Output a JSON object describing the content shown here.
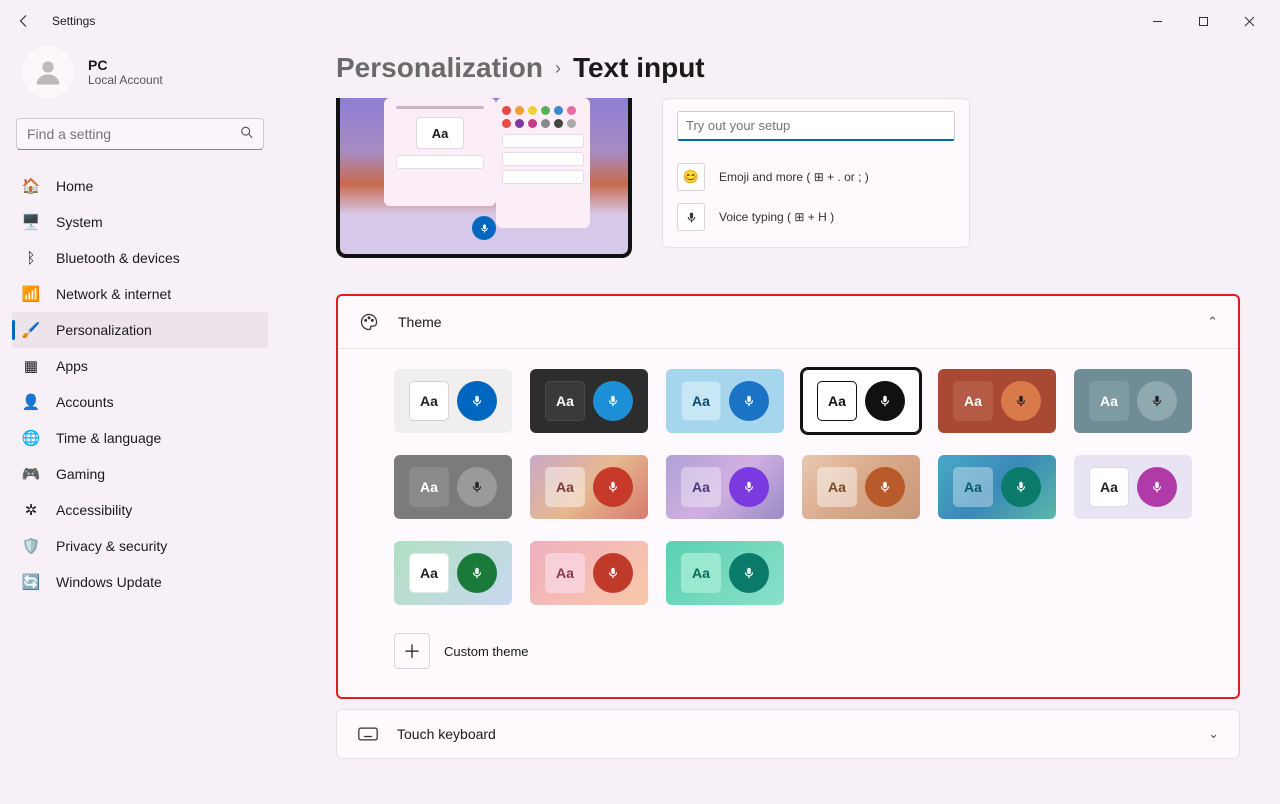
{
  "window": {
    "title": "Settings"
  },
  "profile": {
    "name": "PC",
    "sub": "Local Account"
  },
  "search": {
    "placeholder": "Find a setting"
  },
  "nav": [
    {
      "key": "home",
      "label": "Home",
      "icon": "🏠"
    },
    {
      "key": "system",
      "label": "System",
      "icon": "🖥️"
    },
    {
      "key": "bluetooth",
      "label": "Bluetooth & devices",
      "icon": "ᛒ"
    },
    {
      "key": "network",
      "label": "Network & internet",
      "icon": "📶"
    },
    {
      "key": "personalization",
      "label": "Personalization",
      "icon": "🖌️",
      "selected": true
    },
    {
      "key": "apps",
      "label": "Apps",
      "icon": "▦"
    },
    {
      "key": "accounts",
      "label": "Accounts",
      "icon": "👤"
    },
    {
      "key": "time",
      "label": "Time & language",
      "icon": "🌐"
    },
    {
      "key": "gaming",
      "label": "Gaming",
      "icon": "🎮"
    },
    {
      "key": "accessibility",
      "label": "Accessibility",
      "icon": "✲"
    },
    {
      "key": "privacy",
      "label": "Privacy & security",
      "icon": "🛡️"
    },
    {
      "key": "update",
      "label": "Windows Update",
      "icon": "🔄"
    }
  ],
  "breadcrumb": {
    "parent": "Personalization",
    "current": "Text input"
  },
  "tryout": {
    "placeholder": "Try out your setup",
    "emoji_label": "Emoji and more ( ⊞ + . or ; )",
    "voice_label": "Voice typing ( ⊞ + H )"
  },
  "theme_section": {
    "title": "Theme",
    "aa": "Aa",
    "custom_label": "Custom theme"
  },
  "themes": [
    {
      "bg": "#f1eef0",
      "aa_bg": "#ffffff",
      "aa_fg": "#222222",
      "aa_border": "#d8d0d5",
      "mic_bg": "#0067c0",
      "mic_fg": "#ffffff"
    },
    {
      "bg": "#2d2d2d",
      "aa_bg": "#3a3a3a",
      "aa_fg": "#ffffff",
      "aa_border": "#4a4a4a",
      "mic_bg": "#1e90d8",
      "mic_fg": "#ffffff"
    },
    {
      "bg": "#a6d5ee",
      "aa_bg": "#c7e7f5",
      "aa_fg": "#0b4a6f",
      "aa_border": "#b0dcef",
      "mic_bg": "#1a73c4",
      "mic_fg": "#ffffff"
    },
    {
      "bg": "#ffffff",
      "aa_bg": "#ffffff",
      "aa_fg": "#111111",
      "aa_border": "#111111",
      "mic_bg": "#111111",
      "mic_fg": "#ffffff",
      "selected": true
    },
    {
      "bg": "#a84a33",
      "aa_bg": "#b55a44",
      "aa_fg": "#ffffff",
      "aa_border": "#b55a44",
      "mic_bg": "#d87a4a",
      "mic_fg": "#222222"
    },
    {
      "bg": "#6f8d96",
      "aa_bg": "#7e9aa2",
      "aa_fg": "#ffffff",
      "aa_border": "#7e9aa2",
      "mic_bg": "#8fa9b0",
      "mic_fg": "#222222"
    },
    {
      "bg": "#7b7b7b",
      "aa_bg": "#8a8a8a",
      "aa_fg": "#ffffff",
      "aa_border": "#8a8a8a",
      "mic_bg": "#9a9a9a",
      "mic_fg": "#222222"
    },
    {
      "bg": "linear-gradient(135deg,#c9a9c8,#e6b88f,#d77a6e)",
      "aa_bg": "rgba(255,255,255,.45)",
      "aa_fg": "#7a3a3a",
      "aa_border": "transparent",
      "mic_bg": "#c73a2a",
      "mic_fg": "#ffffff"
    },
    {
      "bg": "linear-gradient(135deg,#b0a0d8,#d0b0e0,#9a8ac8)",
      "aa_bg": "rgba(255,255,255,.35)",
      "aa_fg": "#4a3a7a",
      "aa_border": "transparent",
      "mic_bg": "#7a3ae0",
      "mic_fg": "#ffffff"
    },
    {
      "bg": "linear-gradient(135deg,#e8c8b0,#d8a888,#c89878)",
      "aa_bg": "rgba(255,255,255,.45)",
      "aa_fg": "#7a4a2a",
      "aa_border": "transparent",
      "mic_bg": "#b85a2a",
      "mic_fg": "#ffffff"
    },
    {
      "bg": "linear-gradient(135deg,#4aa8c8,#3a8ab8,#5ab8a8)",
      "aa_bg": "rgba(255,255,255,.35)",
      "aa_fg": "#0a5a6a",
      "aa_border": "transparent",
      "mic_bg": "#0a7a6a",
      "mic_fg": "#ffffff"
    },
    {
      "bg": "#e8e4f4",
      "aa_bg": "#ffffff",
      "aa_fg": "#222222",
      "aa_border": "#e0d8e8",
      "mic_bg": "#b03aa8",
      "mic_fg": "#ffffff"
    },
    {
      "bg": "linear-gradient(135deg,#b0e0c0,#c8d8f0)",
      "aa_bg": "#ffffff",
      "aa_fg": "#222222",
      "aa_border": "#e0e8e0",
      "mic_bg": "#1a7a3a",
      "mic_fg": "#ffffff"
    },
    {
      "bg": "linear-gradient(135deg,#f0b0c0,#f8c8a8)",
      "aa_bg": "#f8d0d8",
      "aa_fg": "#8a3a4a",
      "aa_border": "transparent",
      "mic_bg": "#c03a2a",
      "mic_fg": "#ffffff"
    },
    {
      "bg": "linear-gradient(135deg,#5ad0b0,#8ae0c8)",
      "aa_bg": "#9ae8d0",
      "aa_fg": "#0a6a5a",
      "aa_border": "transparent",
      "mic_bg": "#0a7a6a",
      "mic_fg": "#ffffff"
    }
  ],
  "touch_keyboard": {
    "title": "Touch keyboard"
  }
}
